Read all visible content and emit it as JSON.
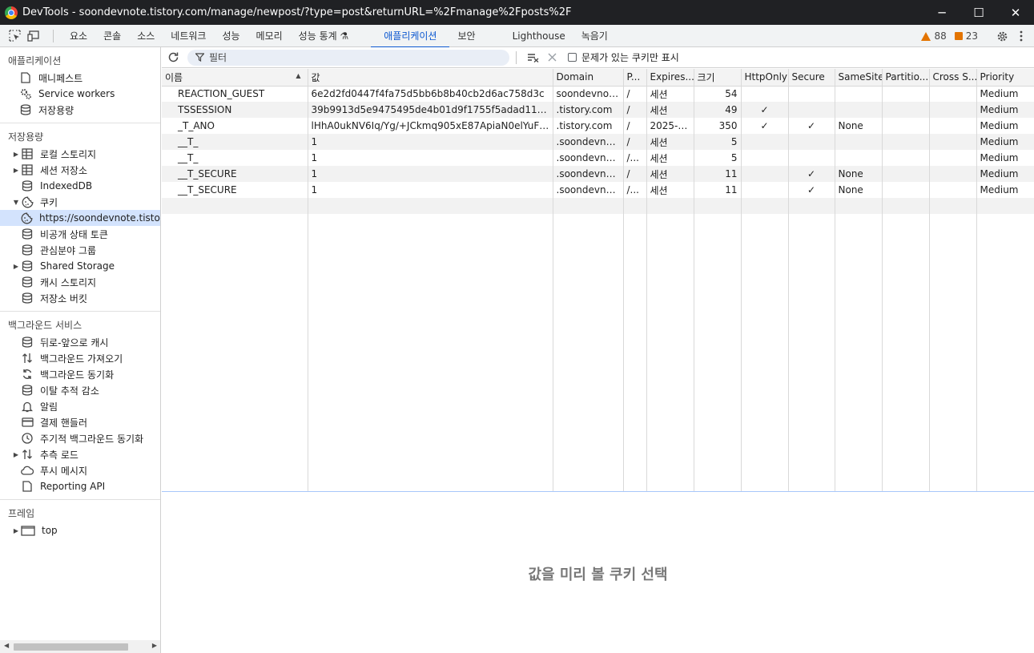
{
  "window": {
    "title": "DevTools - soondevnote.tistory.com/manage/newpost/?type=post&returnURL=%2Fmanage%2Fposts%2F",
    "minimize": "─",
    "maximize": "☐",
    "close": "✕"
  },
  "tabs": [
    {
      "label": "요소"
    },
    {
      "label": "콘솔"
    },
    {
      "label": "소스"
    },
    {
      "label": "네트워크"
    },
    {
      "label": "성능"
    },
    {
      "label": "메모리"
    },
    {
      "label": "성능 통계 ⚗"
    },
    {
      "label": "애플리케이션"
    },
    {
      "label": "보안"
    },
    {
      "label": "Lighthouse"
    },
    {
      "label": "녹음기"
    }
  ],
  "badges": {
    "warnings": "88",
    "issues": "23"
  },
  "sidebar": {
    "application": {
      "title": "애플리케이션",
      "items": [
        {
          "label": "매니페스트",
          "icon": "document-icon"
        },
        {
          "label": "Service workers",
          "icon": "gears-icon"
        },
        {
          "label": "저장용량",
          "icon": "database-icon"
        }
      ]
    },
    "storage": {
      "title": "저장용량",
      "items": [
        {
          "label": "로컬 스토리지",
          "icon": "table-icon"
        },
        {
          "label": "세션 저장소",
          "icon": "table-icon"
        },
        {
          "label": "IndexedDB",
          "icon": "database-icon"
        },
        {
          "label": "쿠키",
          "icon": "cookie-icon"
        },
        {
          "label": "https://soondevnote.tistory.com",
          "icon": "cookie-icon"
        },
        {
          "label": "비공개 상태 토큰",
          "icon": "database-icon"
        },
        {
          "label": "관심분야 그룹",
          "icon": "database-icon"
        },
        {
          "label": "Shared Storage",
          "icon": "database-icon"
        },
        {
          "label": "캐시 스토리지",
          "icon": "database-icon"
        },
        {
          "label": "저장소 버킷",
          "icon": "database-icon"
        }
      ]
    },
    "background": {
      "title": "백그라운드 서비스",
      "items": [
        {
          "label": "뒤로-앞으로 캐시",
          "icon": "database-icon"
        },
        {
          "label": "백그라운드 가져오기",
          "icon": "swap-arrows-icon"
        },
        {
          "label": "백그라운드 동기화",
          "icon": "sync-icon"
        },
        {
          "label": "이탈 추적 감소",
          "icon": "database-icon"
        },
        {
          "label": "알림",
          "icon": "bell-icon"
        },
        {
          "label": "결제 핸들러",
          "icon": "card-icon"
        },
        {
          "label": "주기적 백그라운드 동기화",
          "icon": "clock-icon"
        },
        {
          "label": "추측 로드",
          "icon": "swap-arrows-icon"
        },
        {
          "label": "푸시 메시지",
          "icon": "cloud-icon"
        },
        {
          "label": "Reporting API",
          "icon": "document-icon"
        }
      ]
    },
    "frames": {
      "title": "프레임",
      "items": [
        {
          "label": "top",
          "icon": "frame-icon"
        }
      ]
    }
  },
  "toolbar": {
    "filter_placeholder": "필터",
    "only_issues_label": "문제가 있는 쿠키만 표시"
  },
  "table": {
    "columns": [
      "이름",
      "값",
      "Domain",
      "P...",
      "Expires...",
      "크기",
      "HttpOnly",
      "Secure",
      "SameSite",
      "Partitio...",
      "Cross S...",
      "Priority"
    ],
    "rows": [
      {
        "name": "REACTION_GUEST",
        "value": "6e2d2fd0447f4fa75d5bb6b8b40cb2d6ac758d3c",
        "domain": "soondevnot...",
        "path": "/",
        "expires": "세션",
        "size": "54",
        "httponly": "",
        "secure": "",
        "samesite": "",
        "partition": "",
        "cross": "",
        "priority": "Medium"
      },
      {
        "name": "TSSESSION",
        "value": "39b9913d5e9475495de4b01d9f1755f5adad111a",
        "domain": ".tistory.com",
        "path": "/",
        "expires": "세션",
        "size": "49",
        "httponly": "✓",
        "secure": "",
        "samesite": "",
        "partition": "",
        "cross": "",
        "priority": "Medium"
      },
      {
        "name": "_T_ANO",
        "value": "lHhA0ukNV6Iq/Yg/+JCkmq905xE87ApiaN0elYuFM7...",
        "domain": ".tistory.com",
        "path": "/",
        "expires": "2025-0...",
        "size": "350",
        "httponly": "✓",
        "secure": "✓",
        "samesite": "None",
        "partition": "",
        "cross": "",
        "priority": "Medium"
      },
      {
        "name": "__T_",
        "value": "1",
        "domain": ".soondevnot...",
        "path": "/",
        "expires": "세션",
        "size": "5",
        "httponly": "",
        "secure": "",
        "samesite": "",
        "partition": "",
        "cross": "",
        "priority": "Medium"
      },
      {
        "name": "__T_",
        "value": "1",
        "domain": ".soondevnot...",
        "path": "/...",
        "expires": "세션",
        "size": "5",
        "httponly": "",
        "secure": "",
        "samesite": "",
        "partition": "",
        "cross": "",
        "priority": "Medium"
      },
      {
        "name": "__T_SECURE",
        "value": "1",
        "domain": ".soondevnot...",
        "path": "/",
        "expires": "세션",
        "size": "11",
        "httponly": "",
        "secure": "✓",
        "samesite": "None",
        "partition": "",
        "cross": "",
        "priority": "Medium"
      },
      {
        "name": "__T_SECURE",
        "value": "1",
        "domain": ".soondevnot...",
        "path": "/...",
        "expires": "세션",
        "size": "11",
        "httponly": "",
        "secure": "✓",
        "samesite": "None",
        "partition": "",
        "cross": "",
        "priority": "Medium"
      }
    ]
  },
  "preview": {
    "message": "값을 미리 볼 쿠키 선택"
  }
}
